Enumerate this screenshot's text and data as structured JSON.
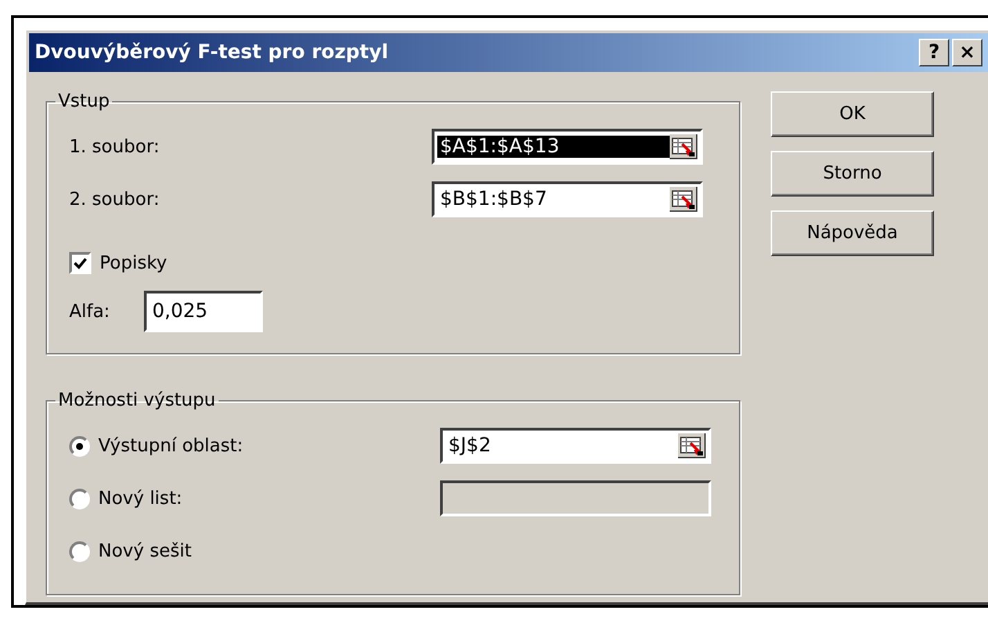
{
  "window": {
    "title": "Dvouvýběrový F-test pro rozptyl",
    "title_buttons": [
      "?",
      "×"
    ]
  },
  "input_group": {
    "title": "Vstup",
    "ranges": [
      {
        "label": "1. soubor:",
        "value": "$A$1:$A$13",
        "selected": true
      },
      {
        "label": "2. soubor:",
        "value": "$B$1:$B$7",
        "selected": false
      }
    ],
    "labels_checkbox": {
      "label": "Popisky",
      "checked": true
    },
    "alpha": {
      "label": "Alfa:",
      "value": "0,025"
    }
  },
  "output_group": {
    "title": "Možnosti výstupu",
    "options": [
      {
        "label": "Výstupní oblast:",
        "selected": true,
        "field": {
          "value": "$J$2",
          "disabled": false,
          "picker": true
        }
      },
      {
        "label": "Nový list:",
        "selected": false,
        "field": {
          "disabled": true,
          "picker": false
        }
      },
      {
        "label": "Nový sešit",
        "selected": false
      }
    ]
  },
  "buttons": [
    "OK",
    "Storno",
    "Nápověda"
  ]
}
